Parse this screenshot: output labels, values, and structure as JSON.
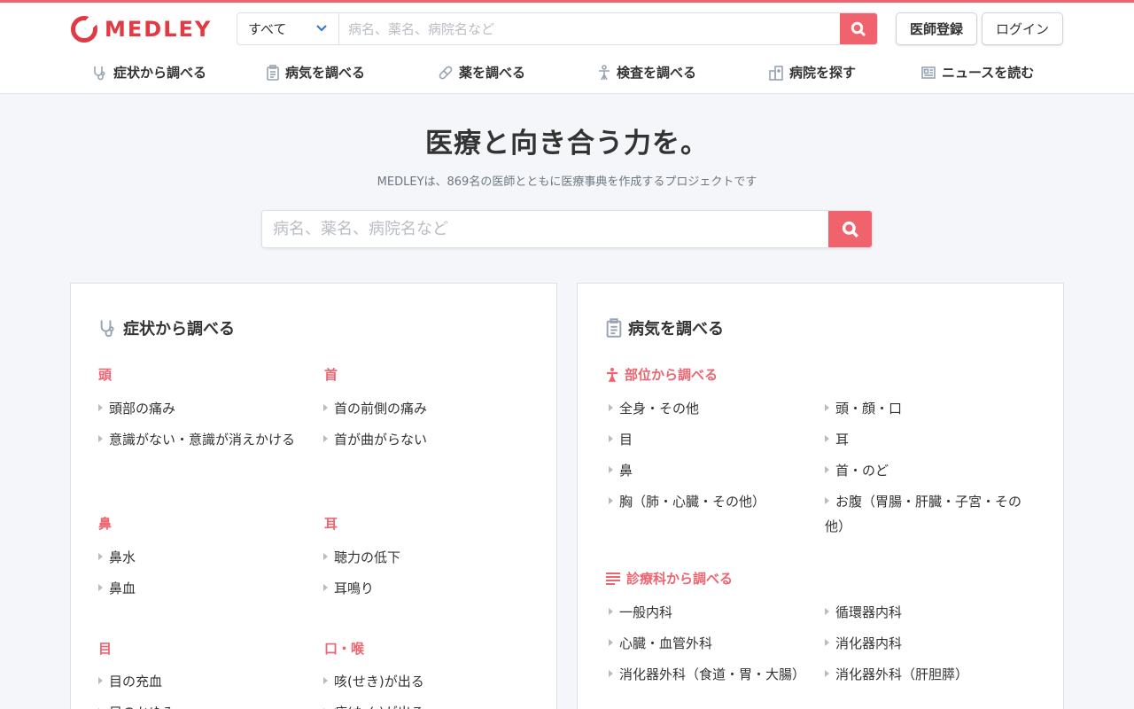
{
  "header": {
    "logo_text": "MEDLEY",
    "search_select_value": "すべて",
    "search_placeholder": "病名、薬名、病院名など",
    "doctor_register_label": "医師登録",
    "login_label": "ログイン"
  },
  "nav": [
    {
      "label": "症状から調べる",
      "icon": "stethoscope-icon"
    },
    {
      "label": "病気を調べる",
      "icon": "clipboard-icon"
    },
    {
      "label": "薬を調べる",
      "icon": "pill-icon"
    },
    {
      "label": "検査を調べる",
      "icon": "person-icon"
    },
    {
      "label": "病院を探す",
      "icon": "hospital-icon"
    },
    {
      "label": "ニュースを読む",
      "icon": "newspaper-icon"
    }
  ],
  "hero": {
    "title": "医療と向き合う力を。",
    "subtitle": "MEDLEYは、869名の医師とともに医療事典を作成するプロジェクトです",
    "search_placeholder": "病名、薬名、病院名など"
  },
  "symptoms": {
    "title": "症状から調べる",
    "groups": [
      {
        "name": "頭",
        "items": [
          "頭部の痛み",
          "意識がない・意識が消えかける"
        ]
      },
      {
        "name": "首",
        "items": [
          "首の前側の痛み",
          "首が曲がらない"
        ]
      },
      {
        "name": "鼻",
        "items": [
          "鼻水",
          "鼻血"
        ]
      },
      {
        "name": "耳",
        "items": [
          "聴力の低下",
          "耳鳴り"
        ]
      },
      {
        "name": "目",
        "items": [
          "目の充血",
          "目のかゆみ"
        ]
      },
      {
        "name": "口・喉",
        "items": [
          "咳(せき)が出る",
          "痰(たん)が出る"
        ]
      }
    ]
  },
  "diseases": {
    "title": "病気を調べる",
    "by_part": {
      "title": "部位から調べる",
      "items": [
        "全身・その他",
        "頭・顔・口",
        "目",
        "耳",
        "鼻",
        "首・のど",
        "胸（肺・心臓・その他）",
        "お腹（胃腸・肝臓・子宮・その他）"
      ]
    },
    "by_dept": {
      "title": "診療科から調べる",
      "items": [
        "一般内科",
        "循環器内科",
        "心臓・血管外科",
        "消化器内科",
        "消化器外科（食道・胃・大腸）",
        "消化器外科（肝胆膵）"
      ]
    }
  },
  "colors": {
    "accent": "#ec6570",
    "brand": "#e03a44",
    "icon": "#98a4b3"
  }
}
